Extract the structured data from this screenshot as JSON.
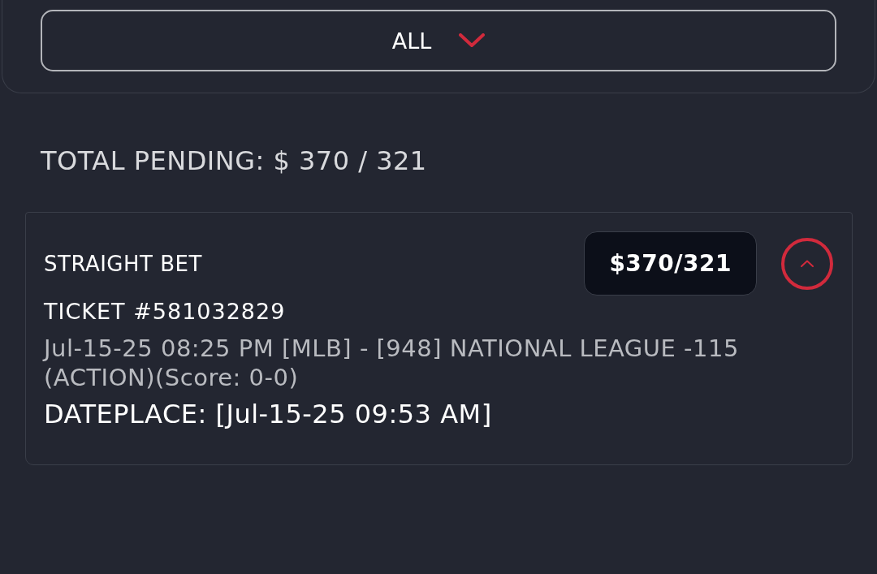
{
  "filter": {
    "label": "ALL",
    "expanded": false
  },
  "total_pending": "TOTAL PENDING: $ 370 / 321",
  "bets": [
    {
      "type": "STRAIGHT BET",
      "amount": "$370/321",
      "expanded": true,
      "ticket": "TICKET #581032829",
      "description": "Jul-15-25 08:25 PM [MLB] - [948] NATIONAL LEAGUE -115 (ACTION)(Score: 0-0)",
      "date_placed": "DATEPLACE: [Jul-15-25 09:53 AM]"
    }
  ]
}
